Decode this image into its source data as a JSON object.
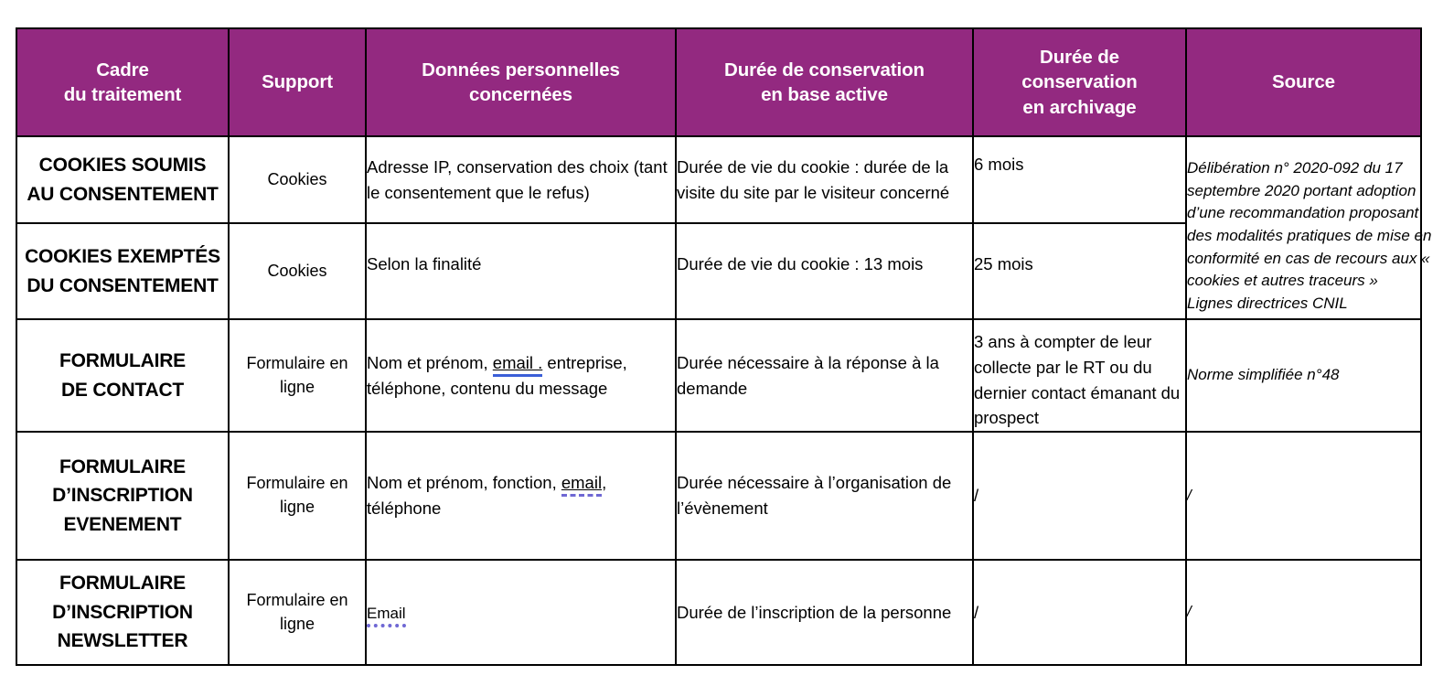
{
  "table": {
    "accent_color": "#932980",
    "header_text_color": "#ffffff",
    "border_color": "#000000",
    "link_underline_color": "#3b5fd8",
    "spellcheck_underline_color": "#6f68d4",
    "columns": [
      {
        "id": "cadre",
        "line1": "Cadre",
        "line2": "du traitement"
      },
      {
        "id": "support",
        "line1": "Support",
        "line2": ""
      },
      {
        "id": "donnees",
        "line1": "Données personnelles",
        "line2": "concernées"
      },
      {
        "id": "active",
        "line1": "Durée de conservation",
        "line2": "en base active"
      },
      {
        "id": "archivage",
        "line1": "Durée de",
        "line2": "conservation",
        "line3": "en archivage"
      },
      {
        "id": "source",
        "line1": "Source",
        "line2": ""
      }
    ],
    "rows": [
      {
        "cadre_line1": "COOKIES SOUMIS",
        "cadre_line2": "AU CONSENTEMENT",
        "support": "Cookies",
        "donnees": "Adresse IP, conservation des choix (tant le consentement que le refus)",
        "duree_active": "Durée de vie du cookie : durée de la visite du site par le visiteur concerné",
        "duree_archivage": "6 mois"
      },
      {
        "cadre_line1": "COOKIES EXEMPTÉS",
        "cadre_line2": "DU CONSENTEMENT",
        "support": "Cookies",
        "donnees": "Selon la finalité",
        "duree_active": "Durée de vie du cookie : 13 mois",
        "duree_archivage": "25 mois"
      },
      {
        "cadre_line1": "FORMULAIRE",
        "cadre_line2": "DE CONTACT",
        "support": "Formulaire en ligne",
        "donnees_before": "Nom et prénom, ",
        "donnees_link": "email .",
        "donnees_after": " entreprise, téléphone, contenu du message",
        "duree_active": "Durée nécessaire à la réponse à la demande",
        "duree_archivage": "3 ans à compter de leur collecte par le RT ou du dernier contact émanant du prospect",
        "source": "Norme simplifiée n°48"
      },
      {
        "cadre_line1": "FORMULAIRE",
        "cadre_line2": "D’INSCRIPTION",
        "cadre_line3": "EVENEMENT",
        "support": "Formulaire en ligne",
        "donnees_before": "Nom et prénom, fonction, ",
        "donnees_link": "email",
        "donnees_after": ", téléphone",
        "duree_active": "Durée nécessaire à l’organisation de l’évènement",
        "duree_archivage": "/",
        "source": "/"
      },
      {
        "cadre_line1": "FORMULAIRE",
        "cadre_line2": "D’INSCRIPTION",
        "cadre_line3": "NEWSLETTER",
        "support": "Formulaire en ligne",
        "donnees_link": "Email",
        "duree_active": "Durée de l’inscription de la personne",
        "duree_archivage": "/",
        "source": "/"
      }
    ],
    "source_cookies": {
      "l1": "Délibération n° 2020-092 du 17",
      "l2": "septembre 2020 portant adoption",
      "l3": "d’une recommandation proposant",
      "l4": "des modalités pratiques de mise en",
      "l5": "conformité en cas de recours aux «",
      "l6": "cookies et autres traceurs »",
      "l7": "Lignes directrices CNIL"
    }
  }
}
